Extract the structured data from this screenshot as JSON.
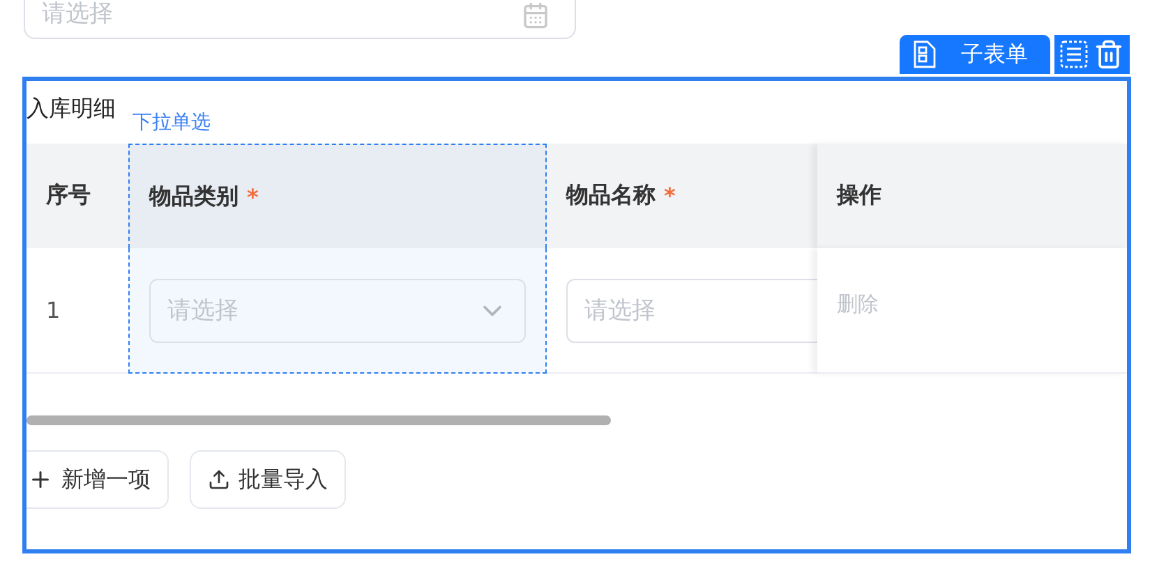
{
  "top_field": {
    "placeholder": "请选择"
  },
  "toolbar": {
    "label": "子表单"
  },
  "subform": {
    "title": "入库明细",
    "selected_field_label": "下拉单选",
    "required_mark": "*",
    "columns": [
      {
        "label": "序号",
        "required": false,
        "selected": false
      },
      {
        "label": "物品类别",
        "required": true,
        "selected": true
      },
      {
        "label": "物品名称",
        "required": true,
        "selected": false
      },
      {
        "label": "操作",
        "required": false,
        "selected": false
      }
    ],
    "rows": [
      {
        "index": "1",
        "category_placeholder": "请选择",
        "name_placeholder": "请选择",
        "action": "删除"
      }
    ],
    "buttons": [
      {
        "kind": "add",
        "label": "新增一项"
      },
      {
        "kind": "import",
        "label": "批量导入"
      }
    ]
  }
}
